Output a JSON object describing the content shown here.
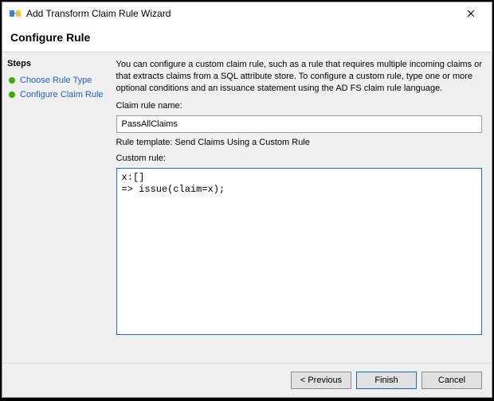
{
  "window": {
    "title": "Add Transform Claim Rule Wizard",
    "header": "Configure Rule"
  },
  "sidebar": {
    "title": "Steps",
    "items": [
      {
        "label": "Choose Rule Type"
      },
      {
        "label": "Configure Claim Rule"
      }
    ]
  },
  "main": {
    "instruction": "You can configure a custom claim rule, such as a rule that requires multiple incoming claims or that extracts claims from a SQL attribute store. To configure a custom rule, type one or more optional conditions and an issuance statement using the AD FS claim rule language.",
    "name_label": "Claim rule name:",
    "name_value": "PassAllClaims",
    "template_label": "Rule template: Send Claims Using a Custom Rule",
    "custom_label": "Custom rule:",
    "custom_value": "x:[]\n=> issue(claim=x);"
  },
  "footer": {
    "previous": "< Previous",
    "finish": "Finish",
    "cancel": "Cancel"
  }
}
